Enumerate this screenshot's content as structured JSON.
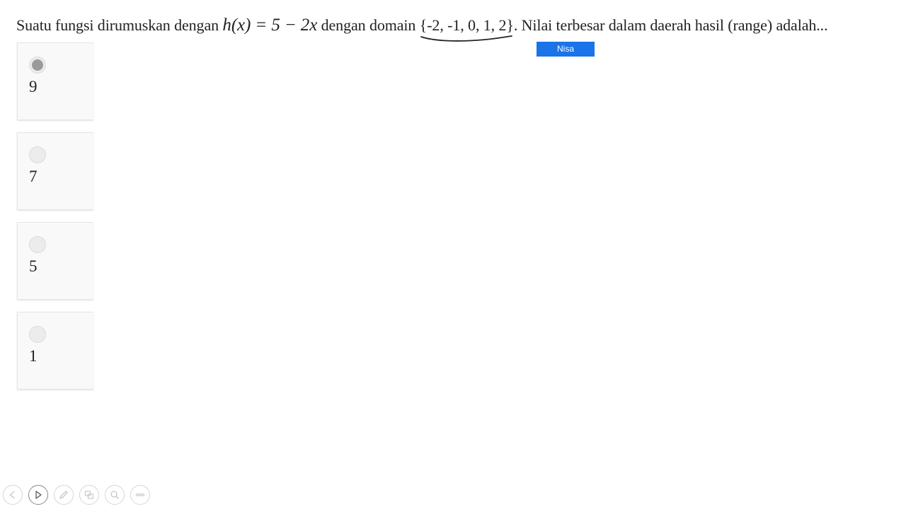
{
  "question": {
    "text_before": "Suatu fungsi dirumuskan dengan ",
    "math_function": "h(x) = 5 − 2x",
    "text_middle": " dengan domain ",
    "domain": "{-2, -1, 0, 1, 2}",
    "text_after": ". Nilai terbesar dalam daerah hasil (range) adalah..."
  },
  "annotation": {
    "label": "Nisa",
    "color": "#1a73e8"
  },
  "options": [
    {
      "label": "9",
      "selected": true
    },
    {
      "label": "7",
      "selected": false
    },
    {
      "label": "5",
      "selected": false
    },
    {
      "label": "1",
      "selected": false
    }
  ],
  "toolbar": {
    "items": [
      "previous-icon",
      "next-icon",
      "pen-icon",
      "slides-icon",
      "zoom-icon",
      "more-icon"
    ]
  }
}
